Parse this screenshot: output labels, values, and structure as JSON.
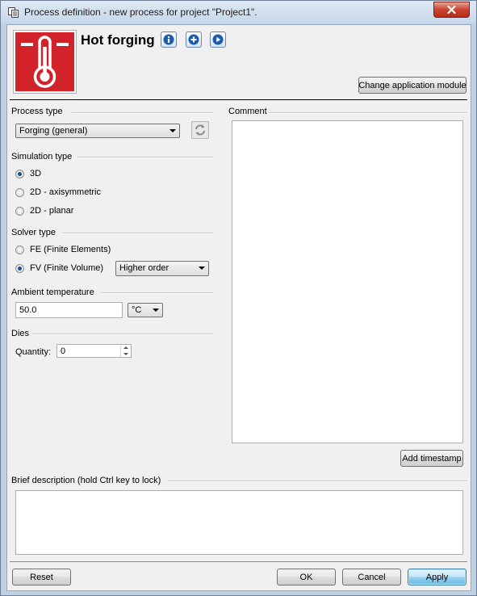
{
  "window": {
    "title": "Process definition - new process for project \"Project1\"."
  },
  "header": {
    "process_name": "Hot forging",
    "change_module_label": "Change application module",
    "icons": [
      "info-icon",
      "add-icon",
      "play-icon"
    ]
  },
  "process_type": {
    "label": "Process type",
    "selected": "Forging (general)"
  },
  "simulation_type": {
    "label": "Simulation type",
    "options": [
      "3D",
      "2D - axisymmetric",
      "2D - planar"
    ],
    "selected": "3D"
  },
  "solver_type": {
    "label": "Solver type",
    "options": [
      "FE (Finite Elements)",
      "FV (Finite Volume)"
    ],
    "selected": "FV (Finite Volume)",
    "order_selected": "Higher order"
  },
  "ambient_temperature": {
    "label": "Ambient temperature",
    "value": "50.0",
    "unit": "°C"
  },
  "dies": {
    "label": "Dies",
    "quantity_label": "Quantity:",
    "quantity": "0"
  },
  "comment": {
    "label": "Comment",
    "value": "",
    "add_timestamp_label": "Add timestamp"
  },
  "brief_description": {
    "label": "Brief description (hold Ctrl key to lock)",
    "value": ""
  },
  "footer": {
    "reset_label": "Reset",
    "ok_label": "OK",
    "cancel_label": "Cancel",
    "apply_label": "Apply"
  },
  "colors": {
    "logo_red": "#d2232a",
    "accent_blue": "#1a5da8"
  }
}
